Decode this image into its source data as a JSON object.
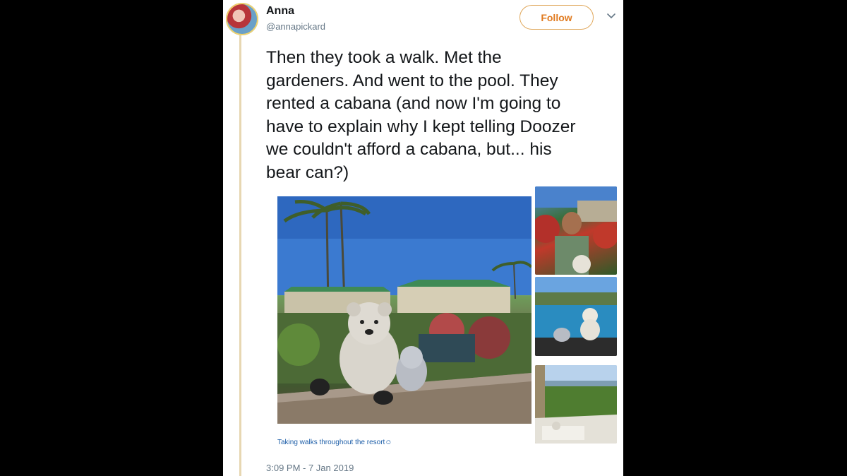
{
  "user": {
    "name": "Anna",
    "handle": "@annapickard"
  },
  "follow_label": "Follow",
  "tweet": {
    "text": "Then they took a walk. Met the\ngardeners. And went to the pool. They\nrented a cabana (and now I'm going to\nhave to explain why I kept telling Doozer\nwe couldn't afford a cabana, but... his\nbear can?)",
    "timestamp": "3:09 PM - 7 Jan 2019"
  },
  "media": {
    "caption_main": "Taking walks throughout the resort☺"
  },
  "colors": {
    "accent": "#e07a1f",
    "thread_line": "#e7d7b2",
    "text": "#14171a",
    "muted": "#657786"
  },
  "icons": {
    "menu": "chevron-down-icon"
  }
}
